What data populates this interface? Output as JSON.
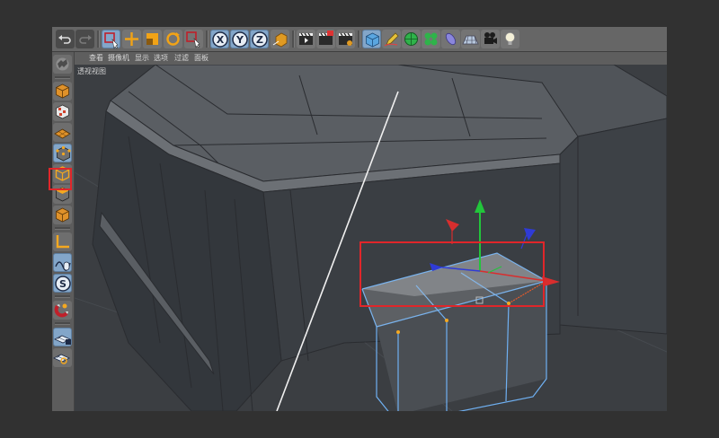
{
  "menu": [
    "查看",
    "摄像机",
    "显示",
    "选项",
    "过滤",
    "面板"
  ],
  "viewport": {
    "label": "透视视图"
  },
  "toolbar": {
    "items": [
      {
        "name": "undo-icon"
      },
      {
        "name": "redo-icon"
      },
      {
        "name": "live-selection-icon"
      },
      {
        "name": "move-icon"
      },
      {
        "name": "scale-icon"
      },
      {
        "name": "rotate-icon"
      },
      {
        "name": "last-tool-icon"
      },
      {
        "name": "x-axis-lock-icon",
        "text": "X"
      },
      {
        "name": "y-axis-lock-icon",
        "text": "Y"
      },
      {
        "name": "z-axis-lock-icon",
        "text": "Z"
      },
      {
        "name": "coordinate-system-icon"
      },
      {
        "name": "render-view-icon"
      },
      {
        "name": "render-picture-viewer-icon"
      },
      {
        "name": "render-settings-icon"
      },
      {
        "name": "cube-icon"
      },
      {
        "name": "pen-icon"
      },
      {
        "name": "subdivision-icon"
      },
      {
        "name": "cloner-icon"
      },
      {
        "name": "deformer-icon"
      },
      {
        "name": "floor-icon"
      },
      {
        "name": "camera-icon"
      },
      {
        "name": "light-icon"
      }
    ]
  },
  "sidebar": {
    "items": [
      {
        "name": "make-editable-icon"
      },
      {
        "name": "model-mode-icon"
      },
      {
        "name": "texture-mode-icon"
      },
      {
        "name": "workplane-mode-icon"
      },
      {
        "name": "points-mode-icon"
      },
      {
        "name": "edges-mode-icon"
      },
      {
        "name": "polygons-mode-icon"
      },
      {
        "name": "axis-mode-icon"
      },
      {
        "name": "tweak-mode-icon"
      },
      {
        "name": "solo-mode-icon",
        "text": "S"
      },
      {
        "name": "snapping-icon"
      },
      {
        "name": "workplane-lock-icon"
      },
      {
        "name": "workplane-align-icon"
      }
    ]
  },
  "colors": {
    "highlight": "#83a6c9",
    "annotation_red": "#e0262a",
    "selection_blue": "#6fb0f2",
    "axis_green": "#22c53b",
    "axis_red": "#d82e2e",
    "axis_blue": "#2f3bd6"
  }
}
